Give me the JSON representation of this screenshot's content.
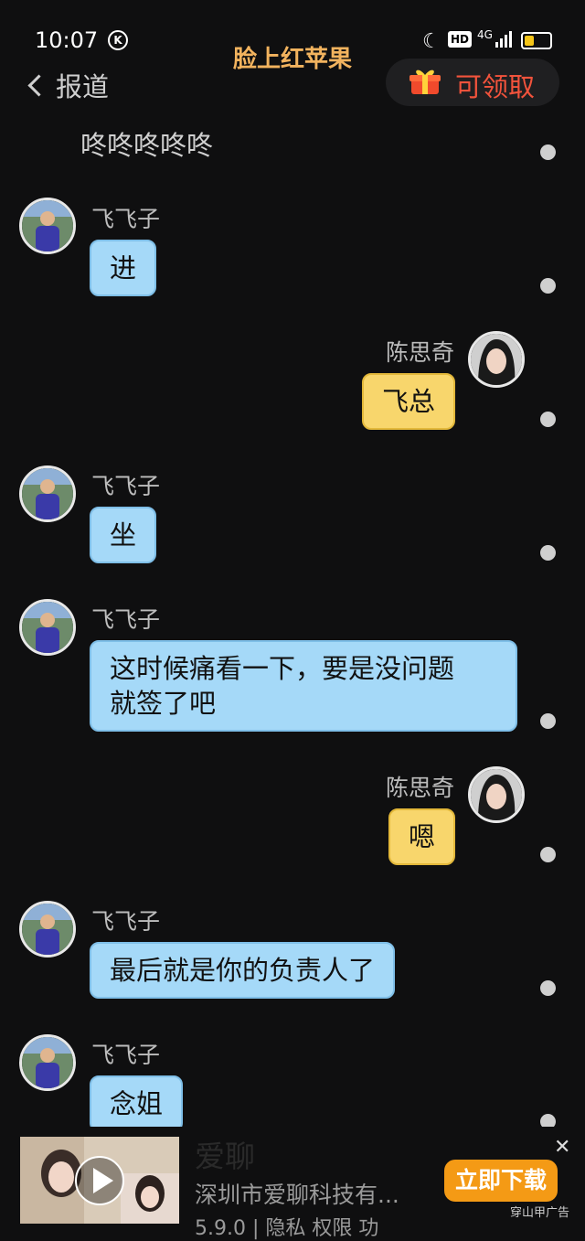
{
  "status": {
    "time": "10:07",
    "k_badge": "K",
    "hd": "HD",
    "network": "4G"
  },
  "header": {
    "title": "脸上红苹果",
    "back_label": "报道",
    "claim_label": "可领取"
  },
  "top_text": "咚咚咚咚咚",
  "messages": [
    {
      "sender": "飞飞子",
      "text": "进"
    },
    {
      "sender": "陈思奇",
      "text": "飞总"
    },
    {
      "sender": "飞飞子",
      "text": "坐"
    },
    {
      "sender": "飞飞子",
      "text_line1": "这时候痛看一下，要是没问题",
      "text_line2": "就签了吧"
    },
    {
      "sender": "陈思奇",
      "text": "嗯"
    },
    {
      "sender": "飞飞子",
      "text": "最后就是你的负责人了"
    },
    {
      "sender": "飞飞子",
      "text": "念姐"
    }
  ],
  "ad": {
    "title": "爱聊",
    "subtitle": "深圳市爱聊科技有...",
    "meta": "5.9.0 | 隐私  权限  功",
    "button": "立即下载",
    "tag": "穿山甲广告",
    "close": "✕"
  },
  "colors": {
    "blue_bubble": "#a5d9f8",
    "yellow_bubble": "#f8d66c",
    "title": "#f2b35e",
    "claim": "#f2533c",
    "ad_button": "#f49a15"
  }
}
